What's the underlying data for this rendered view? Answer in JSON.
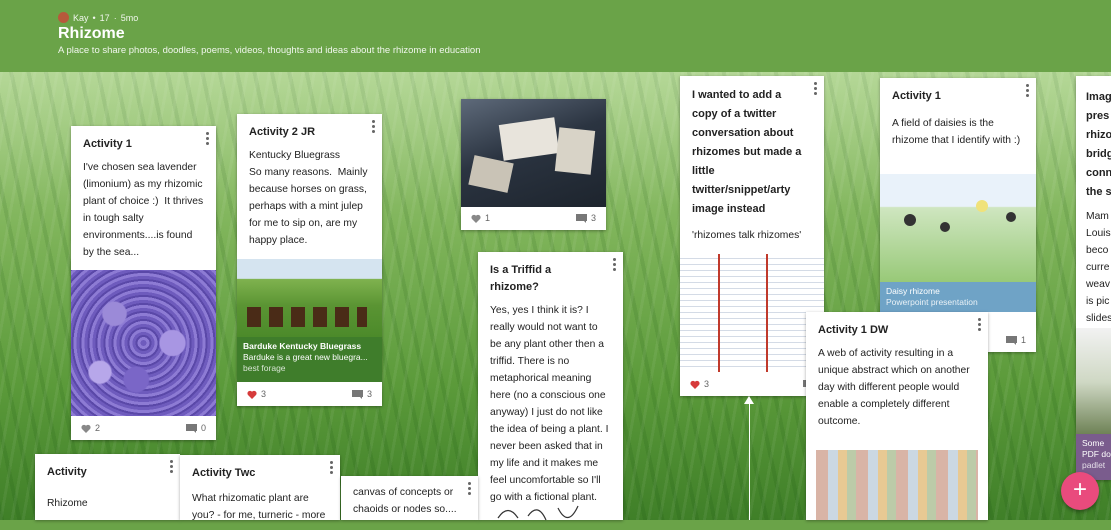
{
  "header": {
    "author": "Kay",
    "points": "17",
    "age": "5mo",
    "title": "Rhizome",
    "description": "A place to share photos, doodles, poems, videos, thoughts and ideas about the rhizome in education"
  },
  "posts": [
    {
      "title": "Activity 1",
      "body": "I've chosen sea lavender (limonium) as my rhizomic plant of choice :)  It thrives in tough salty environments....is found by the sea...",
      "likes": "2",
      "comments": "0"
    },
    {
      "title": "Activity 2 JR",
      "body": "Kentucky Bluegrass\nSo many reasons.  Mainly because horses on grass, perhaps with a mint julep for me to sip on, are my happy place.",
      "caption_title": "Barduke Kentucky Bluegrass",
      "caption_text": "Barduke is a great new bluegra...",
      "caption_sub": "best forage",
      "likes": "3",
      "comments": "3"
    },
    {
      "likes": "1",
      "comments": "3"
    },
    {
      "title": "Is a Triffid a rhizome?",
      "body": "Yes, yes I think it is? I really would not want to be any plant other then a triffid. There is no metaphorical meaning here (no a conscious one anyway) I just do not like the idea of being a plant. I never been asked that in my life and it makes me feel uncomfortable so I'll go with a fictional plant."
    },
    {
      "title": "I wanted to add a copy of a twitter conversation about rhizomes but made a little twitter/snippet/arty image instead",
      "body": "'rhizomes talk rhizomes'",
      "likes": "3"
    },
    {
      "title": "Activity 1",
      "body": "A field of daisies is the rhizome that I identify with :)",
      "caption_title": "Daisy rhizome",
      "caption_text": "Powerpoint presentation",
      "comments": "1"
    },
    {
      "title": "Activity 1 DW",
      "body": "A web of activity resulting in a unique abstract which on another day with different people would enable a completely different outcome."
    },
    {
      "title": "Imag pres rhizo bridg conn the s",
      "body": "Mam Louis beco curre weav is pic slides",
      "caption_title": "Some",
      "caption_text": "PDF do",
      "caption_sub": "padlet"
    },
    {
      "title": "Activity",
      "body": "Rhizome"
    },
    {
      "title": "Activity Twc",
      "body": "What rhizomatic plant are you? - for me, turneric - more"
    },
    {
      "title": "canvas of concepts or chaoids or nodes so...."
    }
  ],
  "colors": {
    "header": "#6aa348",
    "like": "#d63b3b",
    "fab": "#e94b7d"
  },
  "fab": {
    "label": "+"
  }
}
